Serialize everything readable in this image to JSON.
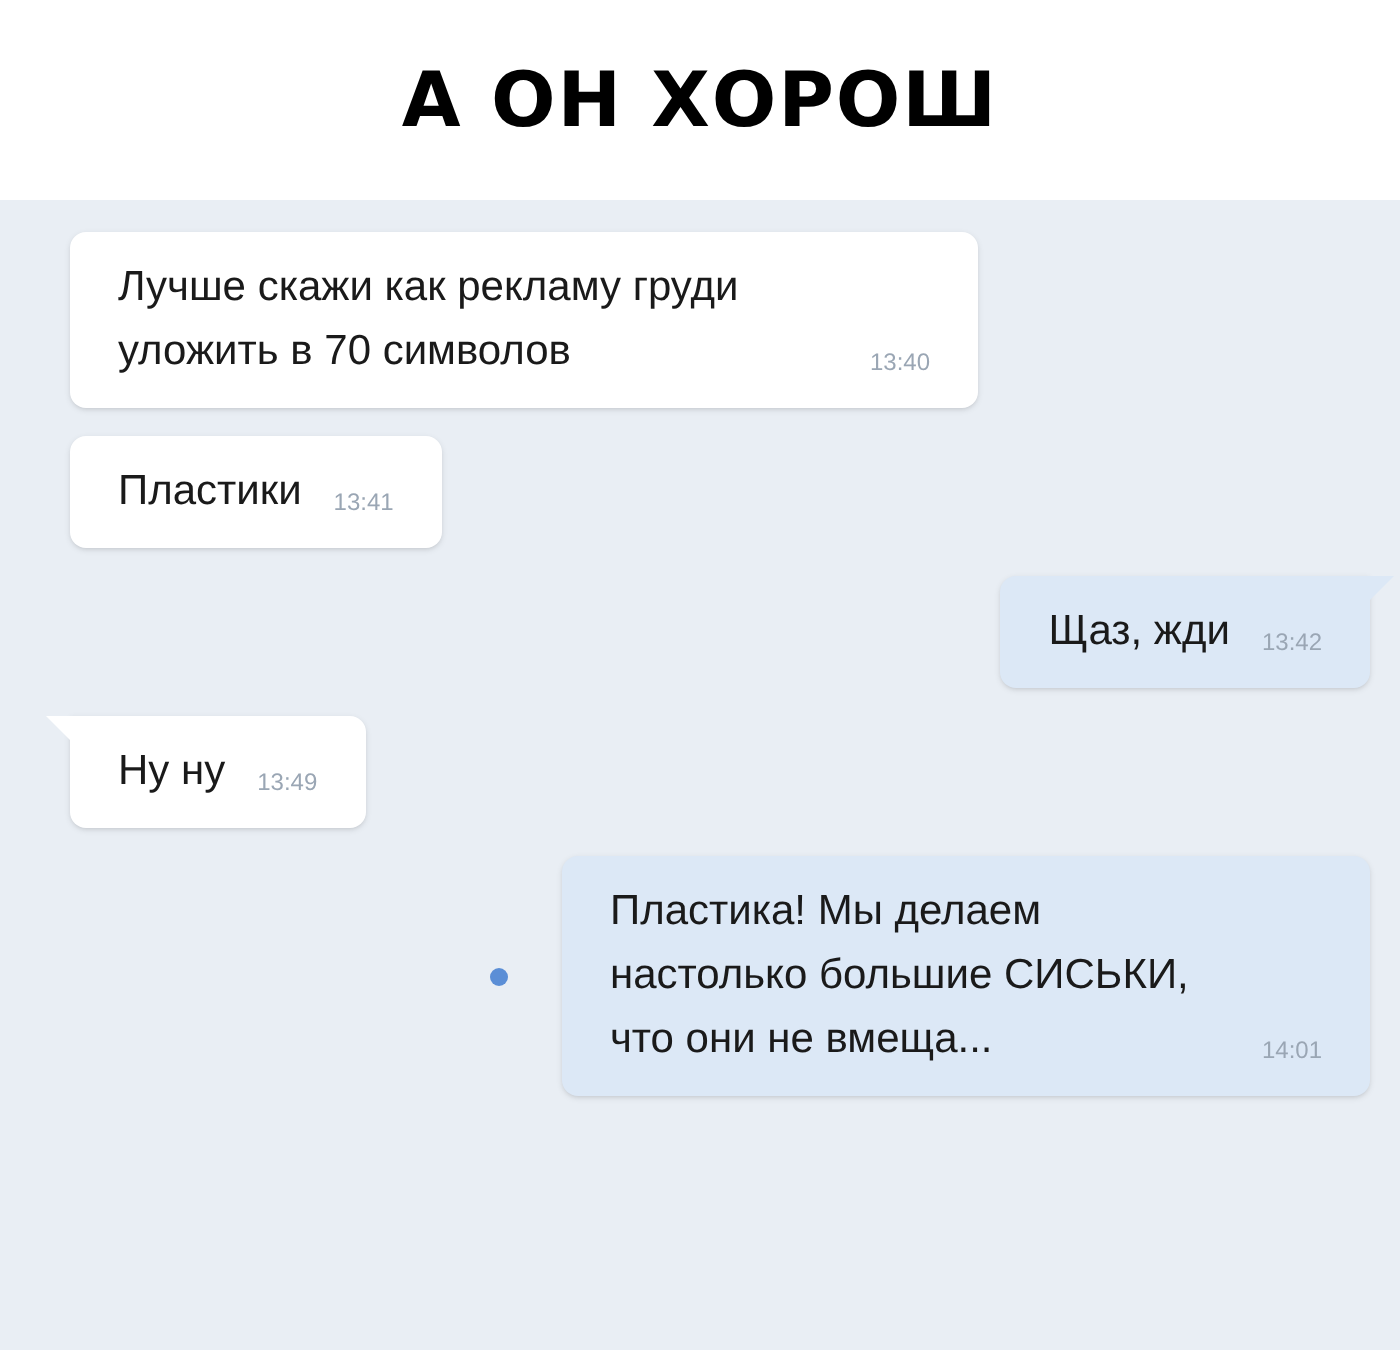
{
  "caption": "А ОН ХОРОШ",
  "messages": [
    {
      "outgoing": false,
      "text": "Лучше скажи как рекламу груди уложить в 70 символов",
      "time": "13:40",
      "tail": false,
      "unread": false
    },
    {
      "outgoing": false,
      "text": "Пластики",
      "time": "13:41",
      "tail": false,
      "unread": false
    },
    {
      "outgoing": true,
      "text": "Щаз, жди",
      "time": "13:42",
      "tail": true,
      "unread": false
    },
    {
      "outgoing": false,
      "text": "Ну ну",
      "time": "13:49",
      "tail": true,
      "unread": false
    },
    {
      "outgoing": true,
      "text": "Пластика! Мы делаем настолько большие СИСЬКИ, что они не вмеща...",
      "time": "14:01",
      "tail": false,
      "unread": true
    }
  ]
}
